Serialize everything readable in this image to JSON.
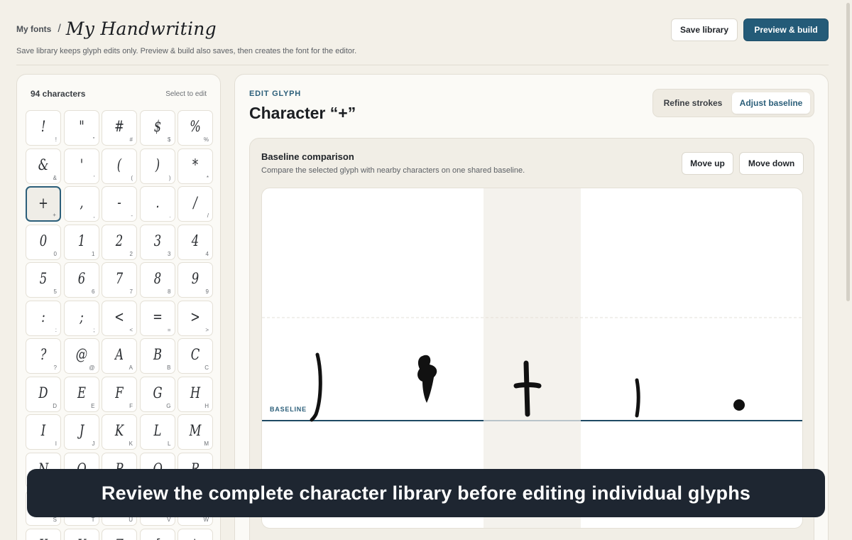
{
  "header": {
    "breadcrumb_link": "My fonts",
    "breadcrumb_sep": "/",
    "title": "My Handwriting",
    "subtitle": "Save library keeps glyph edits only. Preview & build also saves, then creates the font for the editor.",
    "save_label": "Save library",
    "build_label": "Preview & build"
  },
  "library": {
    "count_label": "94 characters",
    "hint": "Select to edit",
    "selected": "+",
    "glyphs": [
      "!",
      "\"",
      "#",
      "$",
      "%",
      "&",
      "'",
      "(",
      ")",
      "*",
      "+",
      ",",
      "-",
      ".",
      "/",
      "0",
      "1",
      "2",
      "3",
      "4",
      "5",
      "6",
      "7",
      "8",
      "9",
      ":",
      ";",
      "<",
      "=",
      ">",
      "?",
      "@",
      "A",
      "B",
      "C",
      "D",
      "E",
      "F",
      "G",
      "H",
      "I",
      "J",
      "K",
      "L",
      "M",
      "N",
      "O",
      "P",
      "Q",
      "R",
      "S",
      "T",
      "U",
      "V",
      "W",
      "X",
      "Y",
      "Z",
      "[",
      "\\"
    ]
  },
  "editor": {
    "kicker": "EDIT GLYPH",
    "title": "Character “+”",
    "toggle": {
      "refine": "Refine strokes",
      "adjust": "Adjust baseline",
      "active": "adjust"
    },
    "comparison": {
      "title": "Baseline comparison",
      "description": "Compare the selected glyph with nearby characters on one shared baseline.",
      "move_up": "Move up",
      "move_down": "Move down",
      "baseline_label": "BASELINE",
      "glyphs": [
        ")",
        "*",
        "+",
        ",",
        "."
      ]
    }
  },
  "caption": "Review the complete character library before editing individual glyphs",
  "colors": {
    "accent": "#245b78",
    "baseline": "#2c5f7a",
    "caption_bg": "#1e2631",
    "page_bg": "#f3f0e8"
  }
}
